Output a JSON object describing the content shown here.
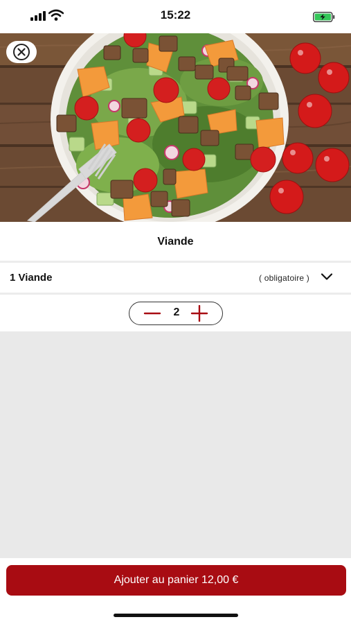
{
  "status_bar": {
    "time": "15:22",
    "icons": [
      "cellular-signal-icon",
      "wifi-icon",
      "battery-charging-icon"
    ]
  },
  "hero": {
    "image": "salad-photo",
    "close_icon": "close-circle-icon"
  },
  "product": {
    "title": "Viande"
  },
  "option": {
    "label": "1 Viande",
    "requirement": "( obligatoire )",
    "chevron_icon": "chevron-down-icon"
  },
  "quantity": {
    "value": "2",
    "minus_icon": "minus-icon",
    "plus_icon": "plus-icon"
  },
  "cart": {
    "label": "Ajouter au panier 12,00 €"
  },
  "colors": {
    "accent": "#a80c12",
    "background_empty": "#e9e9e9",
    "text": "#111111"
  }
}
